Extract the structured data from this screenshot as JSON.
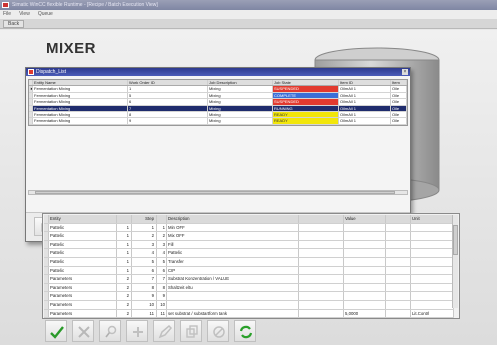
{
  "app": {
    "title": "Simatic WinCC flexible Runtime - [Recipe / Batch Execution View]",
    "menu": [
      "File",
      "View",
      "Queue"
    ],
    "toolbar_label": "Back"
  },
  "screen": {
    "title": "MIXER"
  },
  "queue_window": {
    "title": "Dispatch_List",
    "columns": [
      "",
      "Entity Name",
      "Work Order ID",
      "Job Description",
      "Job State",
      "Item ID",
      "Item"
    ],
    "rows": [
      {
        "marker": "►",
        "entity": "Fermentation Mixing",
        "work_order": "1",
        "job": "Mixing",
        "state": "SUSPENDED",
        "state_type": "suspended",
        "item_id": "OilmAll 1",
        "item": "Oile"
      },
      {
        "marker": "",
        "entity": "Fermentation Mixing",
        "work_order": "5",
        "job": "Mixing",
        "state": "COMPLETE",
        "state_type": "complete",
        "item_id": "OilmAll 1",
        "item": "Oile"
      },
      {
        "marker": "",
        "entity": "Fermentation Mixing",
        "work_order": "6",
        "job": "Mixing",
        "state": "SUSPENDED",
        "state_type": "suspended",
        "item_id": "OilmAll 1",
        "item": "Oile"
      },
      {
        "marker": "",
        "entity": "Fermentation Mixing",
        "work_order": "7",
        "job": "Mixing",
        "state": "RUNNING",
        "state_type": "selected",
        "item_id": "OilmAll 1",
        "item": "Oile"
      },
      {
        "marker": "",
        "entity": "Fermentation Mixing",
        "work_order": "8",
        "job": "Mixing",
        "state": "READY",
        "state_type": "ready",
        "item_id": "OilmAll 1",
        "item": "Oile"
      },
      {
        "marker": "",
        "entity": "Fermentation Mixing",
        "work_order": "9",
        "job": "Mixing",
        "state": "READY",
        "state_type": "ready",
        "item_id": "OilmAll 1",
        "item": "Oile"
      }
    ],
    "buttons": [
      "play",
      "record",
      "pause",
      "search",
      "move",
      "refresh"
    ]
  },
  "operations": {
    "columns": [
      "",
      "Entity",
      "",
      "Step",
      "",
      "Description",
      "",
      "Value",
      "",
      "Unit"
    ],
    "rows": [
      [
        "",
        "Pattelic",
        "1",
        "1",
        "1",
        "Min OFF",
        "",
        "",
        "",
        ""
      ],
      [
        "",
        "Pattelic",
        "1",
        "2",
        "2",
        "Mix OFF",
        "",
        "",
        "",
        ""
      ],
      [
        "",
        "Pattelic",
        "1",
        "3",
        "3",
        "Fill",
        "",
        "",
        "",
        ""
      ],
      [
        "",
        "Pattelic",
        "1",
        "4",
        "4",
        "Pattelic",
        "",
        "",
        "",
        ""
      ],
      [
        "",
        "Pattelic",
        "1",
        "5",
        "5",
        "Transfer",
        "",
        "",
        "",
        ""
      ],
      [
        "",
        "Pattelic",
        "1",
        "6",
        "6",
        "CIP",
        "",
        "",
        "",
        ""
      ],
      [
        "",
        "Parameters",
        "2",
        "7",
        "7",
        "Substrat Konzentration / VALUE",
        "",
        "",
        "",
        ""
      ],
      [
        "",
        "Parameters",
        "2",
        "8",
        "8",
        "Shaltzeit eltu",
        "",
        "",
        "",
        ""
      ],
      [
        "",
        "Parameters",
        "2",
        "9",
        "9",
        "",
        "",
        "",
        "",
        ""
      ],
      [
        "",
        "Parameters",
        "2",
        "10",
        "10",
        "",
        "",
        "",
        "",
        ""
      ],
      [
        "",
        "Parameters",
        "2",
        "11",
        "11",
        "set substrat / substartform tank",
        "",
        "5,0000",
        "",
        "Lit.Contrl"
      ]
    ]
  },
  "bottom_buttons": [
    "accept",
    "reject",
    "search",
    "add",
    "edit",
    "copy",
    "delete",
    "refresh"
  ],
  "colors": {
    "suspended": "#e23a2f",
    "complete": "#3a6fd8",
    "ready": "#f2e60a",
    "selected": "#1f2c6d"
  }
}
